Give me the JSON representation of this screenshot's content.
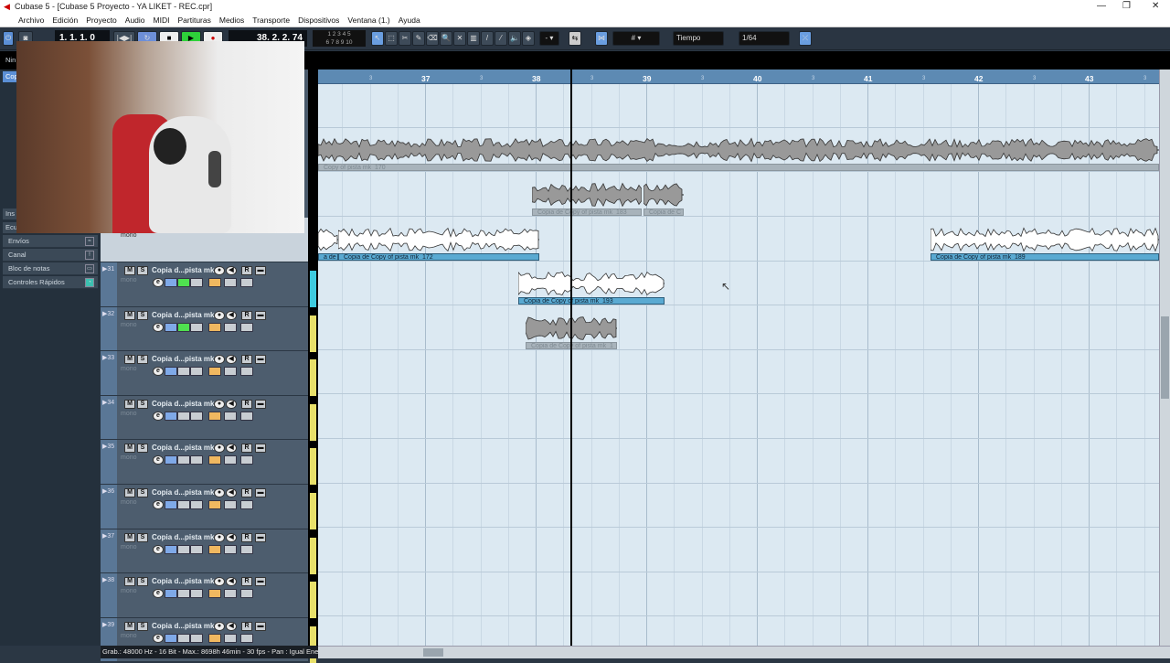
{
  "window": {
    "title": "Cubase 5 - [Cubase 5 Proyecto - YA LIKET - REC.cpr]",
    "controls": [
      "—",
      "❐",
      "✕"
    ]
  },
  "menu": [
    "Archivo",
    "Edición",
    "Proyecto",
    "Audio",
    "MIDI",
    "Partituras",
    "Medios",
    "Transporte",
    "Dispositivos",
    "Ventana (1.)",
    "Ayuda"
  ],
  "toolbar": {
    "left_locator": "1. 1. 1.  0",
    "position": "38. 2. 2. 74",
    "markers_top": "1 2 3 4 5",
    "markers_bottom": "6 7 8 9 10",
    "snap_type": "Tiempo",
    "quantize": "1/64",
    "grid_icon": "grid-icon"
  },
  "inspector": {
    "items": [
      {
        "label": "Envíos"
      },
      {
        "label": "Canal"
      },
      {
        "label": "Bloc de notas"
      },
      {
        "label": "Controles Rápidos"
      }
    ],
    "partial_top": [
      "Nin",
      "Cop",
      "Ins",
      "Ecu"
    ]
  },
  "tracks": [
    {
      "num": "31",
      "name": "Copia d...pista mk",
      "type": "mono",
      "color": "#3ecbe0"
    },
    {
      "num": "32",
      "name": "Copia d...pista mk",
      "type": "mono",
      "color": "#e8e06a"
    },
    {
      "num": "33",
      "name": "Copia d...pista mk",
      "type": "mono",
      "color": "#e8e06a"
    },
    {
      "num": "34",
      "name": "Copia d...pista mk",
      "type": "mono",
      "color": "#e8e06a"
    },
    {
      "num": "35",
      "name": "Copia d...pista mk",
      "type": "mono",
      "color": "#e8e06a"
    },
    {
      "num": "36",
      "name": "Copia d...pista mk",
      "type": "mono",
      "color": "#e8e06a"
    },
    {
      "num": "37",
      "name": "Copia d...pista mk",
      "type": "mono",
      "color": "#e8e06a"
    },
    {
      "num": "38",
      "name": "Copia d...pista mk",
      "type": "mono",
      "color": "#e8e06a"
    },
    {
      "num": "39",
      "name": "Copia d...pista mk",
      "type": "mono",
      "color": "#e8e06a"
    }
  ],
  "track30": {
    "type": "mono"
  },
  "track_buttons": {
    "mute": "M",
    "solo": "S",
    "read": "R",
    "edit": "e"
  },
  "ruler": {
    "bars": [
      "37",
      "38",
      "39",
      "40",
      "41",
      "42",
      "43"
    ],
    "beat_label": "3"
  },
  "events": [
    {
      "label": "Copy of pista mk_170",
      "muted": true
    },
    {
      "label": "Copia de Copy of pista mk_183",
      "muted": true
    },
    {
      "label": "Copia de C",
      "muted": true
    },
    {
      "label": "a de C",
      "muted": false
    },
    {
      "label": "Copia de Copy of pista mk_172",
      "muted": false
    },
    {
      "label": "Copia de Copy of pista mk_189",
      "muted": false
    },
    {
      "label": "Copia de Copy of pista mk_193",
      "muted": false
    },
    {
      "label": "Copia de Copy of pista mk_1",
      "muted": true
    }
  ],
  "status": "Grab.: 48000 Hz - 16 Bit - Max.: 8698h 46min - 30 fps - Pan : Igual Energía",
  "colors": {
    "ruler": "#5d8ab3",
    "arrange_bg": "#dce9f2",
    "event_label": "#5aaad2",
    "toolbar": "#2a3542"
  }
}
